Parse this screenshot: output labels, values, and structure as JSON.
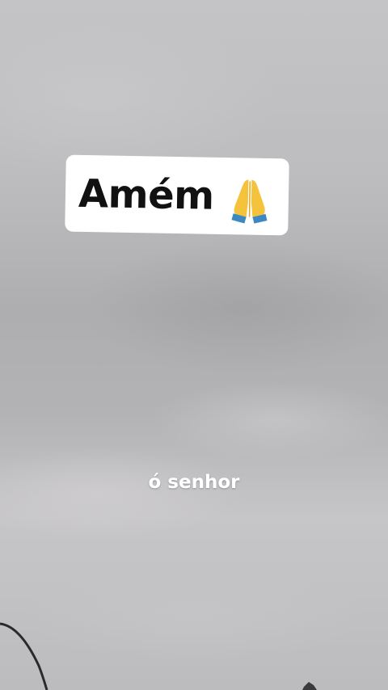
{
  "sticker": {
    "text": "Amém",
    "emoji_icon": "folded-hands-icon"
  },
  "caption": {
    "text": "ó senhor"
  },
  "colors": {
    "sky": "#bdbdbf",
    "sticker_background": "#ffffff",
    "sticker_text": "#111111",
    "caption_text": "#ffffff",
    "emoji_yellow": "#f5c33b",
    "emoji_blue": "#3b88c3"
  }
}
